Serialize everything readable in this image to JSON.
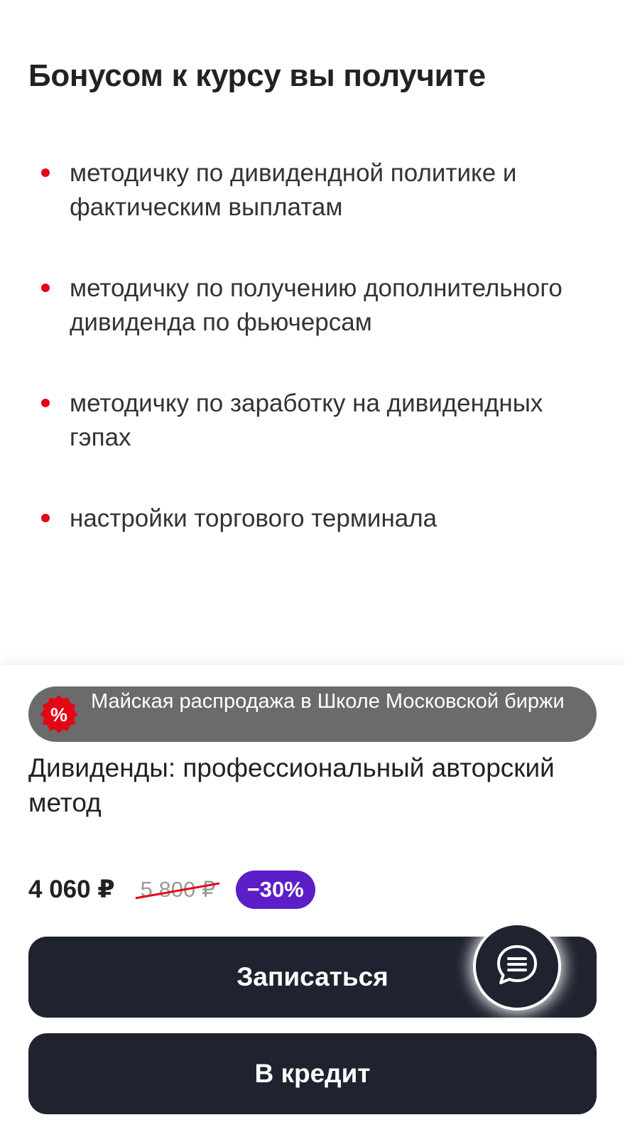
{
  "bonus": {
    "title": "Бонусом к курсу вы получите",
    "items": [
      {
        "text": "методичку по дивидендной политике и фактическим выплатам"
      },
      {
        "text": "методичку по получению дополнительного дивиденда по фьючерсам"
      },
      {
        "text": "методичку по заработку на дивидендных гэпах"
      },
      {
        "text": "настройки торгового терминала"
      }
    ]
  },
  "sale_banner": {
    "icon": "percent-badge-icon",
    "text": "Майская распродажа в Школе Московской биржи"
  },
  "course": {
    "title": "Дивиденды: профессиональный авторский метод"
  },
  "price": {
    "current": "4 060 ₽",
    "old": "5 800 ₽",
    "discount": "−30%"
  },
  "buttons": {
    "enroll_label": "Записаться",
    "credit_label": "В кредит"
  },
  "chat": {
    "icon": "chat-bubble-icon"
  },
  "colors": {
    "accent_red": "#e30613",
    "discount_purple": "#5b1ec7",
    "button_dark": "#1f232f",
    "banner_gray": "#6b6b6b"
  }
}
